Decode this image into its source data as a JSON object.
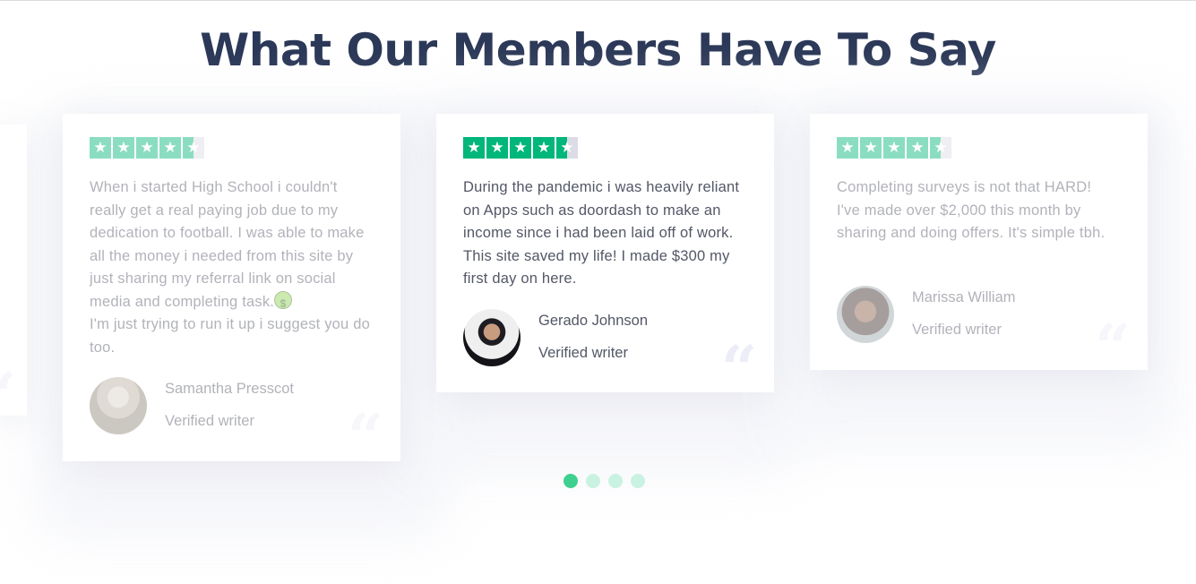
{
  "title": "What Our Members Have To Say",
  "accent_color": "#00b67a",
  "testimonials": [
    {
      "rating_label": "4.5 stars",
      "rating": 4.5,
      "text_1": "When i started High School i couldn't really get a real paying job due to my dedication to football. I was able to make all the money i needed from this site by just sharing my referral link on social media and completing task.",
      "emoji": "money-mouth-face",
      "text_2": "I'm just trying to run it up i suggest you do too.",
      "name": "Samantha Presscot",
      "role": "Verified writer"
    },
    {
      "rating": 4.5,
      "text": "During the pandemic i was heavily reliant on Apps such as doordash to make an income since i had been laid off of work. This site saved my life! I made $300 my first day on here.",
      "name": "Gerado Johnson",
      "role": "Verified writer"
    },
    {
      "rating": 4.5,
      "text": "Completing surveys is not that HARD! I've made over $2,000 this month by sharing and doing offers. It's simple tbh.",
      "name": "Marissa William",
      "role": "Verified writer"
    }
  ],
  "quote_glyph": "“",
  "pagination": {
    "count": 4,
    "active": 1
  }
}
